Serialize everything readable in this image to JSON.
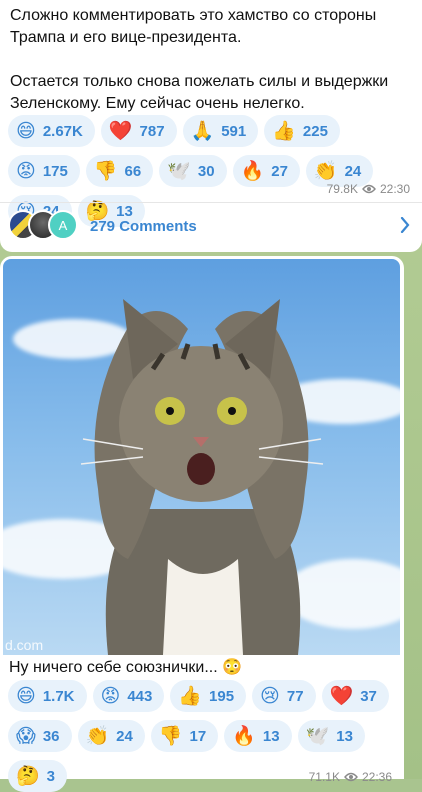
{
  "message1": {
    "text": "Сложно комментировать это хамство со стороны Трампа и его вице-президента.\n\nОстается только снова пожелать силы и выдержки Зеленскому. Ему сейчас очень нелегко.",
    "reactions": [
      {
        "emoji": "😄",
        "count": "2.67K"
      },
      {
        "emoji": "❤️",
        "count": "787"
      },
      {
        "emoji": "🙏",
        "count": "591"
      },
      {
        "emoji": "👍",
        "count": "225"
      },
      {
        "emoji": "😡",
        "count": "175"
      },
      {
        "emoji": "👎",
        "count": "66"
      },
      {
        "emoji": "🕊️",
        "count": "30"
      },
      {
        "emoji": "🔥",
        "count": "27"
      },
      {
        "emoji": "👏",
        "count": "24"
      },
      {
        "emoji": "😢",
        "count": "24"
      },
      {
        "emoji": "🤔",
        "count": "13"
      }
    ],
    "views": "79.8K",
    "time": "22:30",
    "comments_label": "279 Comments",
    "avatar_letter": "A"
  },
  "message2": {
    "image_watermark": "d.com",
    "caption": "Ну ничего себе союзнички... 😳",
    "reactions": [
      {
        "emoji": "😄",
        "count": "1.7K"
      },
      {
        "emoji": "😡",
        "count": "443"
      },
      {
        "emoji": "👍",
        "count": "195"
      },
      {
        "emoji": "😢",
        "count": "77"
      },
      {
        "emoji": "❤️",
        "count": "37"
      },
      {
        "emoji": "😱",
        "count": "36"
      },
      {
        "emoji": "👏",
        "count": "24"
      },
      {
        "emoji": "👎",
        "count": "17"
      },
      {
        "emoji": "🔥",
        "count": "13"
      },
      {
        "emoji": "🕊️",
        "count": "13"
      },
      {
        "emoji": "🤔",
        "count": "3"
      }
    ],
    "views": "71.1K",
    "time": "22:36"
  }
}
